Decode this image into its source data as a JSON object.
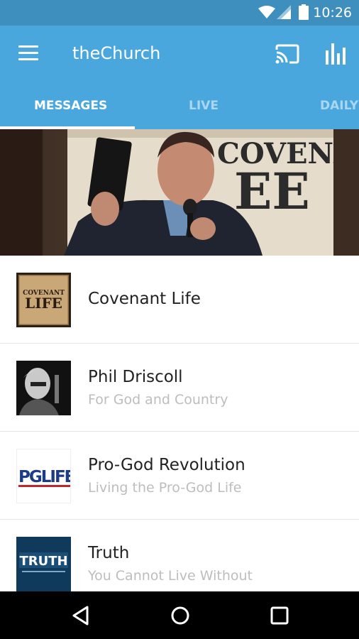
{
  "status_bar": {
    "time": "10:26"
  },
  "app_bar": {
    "title": "theChurch"
  },
  "tabs": [
    {
      "label": "MESSAGES",
      "active": true
    },
    {
      "label": "LIVE",
      "active": false
    },
    {
      "label": "DAILY",
      "active": false
    }
  ],
  "hero": {
    "sign_line1": "COVENANT"
  },
  "items": [
    {
      "title": "Covenant Life",
      "subtitle": "",
      "thumb_text1": "COVENANT",
      "thumb_text2": "LIFE"
    },
    {
      "title": "Phil Driscoll",
      "subtitle": "For God and Country"
    },
    {
      "title": "Pro-God Revolution",
      "subtitle": "Living the Pro-God Life",
      "thumb_text1": "PGLIFE"
    },
    {
      "title": "Truth",
      "subtitle": "You Cannot Live Without",
      "thumb_text1": "TRUTH"
    }
  ],
  "colors": {
    "status_bar": "#3e8fbd",
    "app_bar": "#4aa7dd",
    "nav_bar": "#000000"
  }
}
